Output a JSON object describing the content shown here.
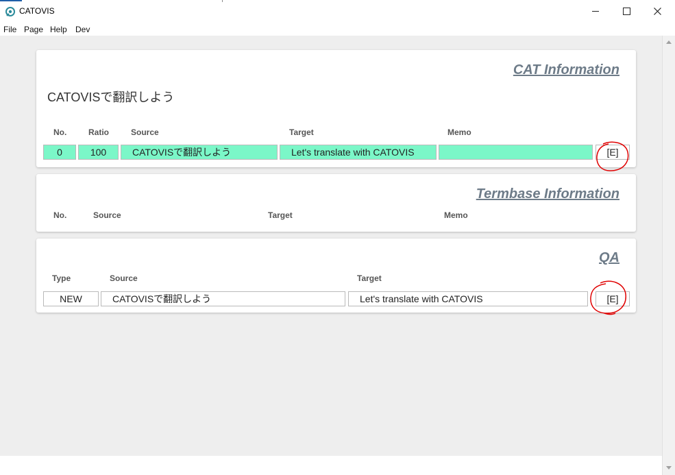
{
  "window": {
    "title": "CATOVIS"
  },
  "menu": [
    "File",
    "Page",
    "Help",
    "Dev"
  ],
  "cat_section": {
    "heading": "CAT Information",
    "segment_source": "CATOVISで翻訳しよう",
    "columns": [
      "No.",
      "Ratio",
      "Source",
      "Target",
      "Memo"
    ],
    "rows": [
      {
        "no": "0",
        "ratio": "100",
        "source": "CATOVISで翻訳しよう",
        "target": "Let's translate with CATOVIS",
        "memo": "",
        "action": "[E]"
      }
    ]
  },
  "termbase_section": {
    "heading": "Termbase Information",
    "columns": [
      "No.",
      "Source",
      "Target",
      "Memo"
    ]
  },
  "qa_section": {
    "heading": "QA",
    "columns": [
      "Type",
      "Source",
      "Target"
    ],
    "rows": [
      {
        "type": "NEW",
        "source": "CATOVISで翻訳しよう",
        "target": "Let's translate with CATOVIS",
        "action": "[E]"
      }
    ]
  },
  "colors": {
    "match_row": "#7bf7c8",
    "heading": "#6d7b88",
    "annotation": "#e00000",
    "background": "#eeeeee"
  }
}
